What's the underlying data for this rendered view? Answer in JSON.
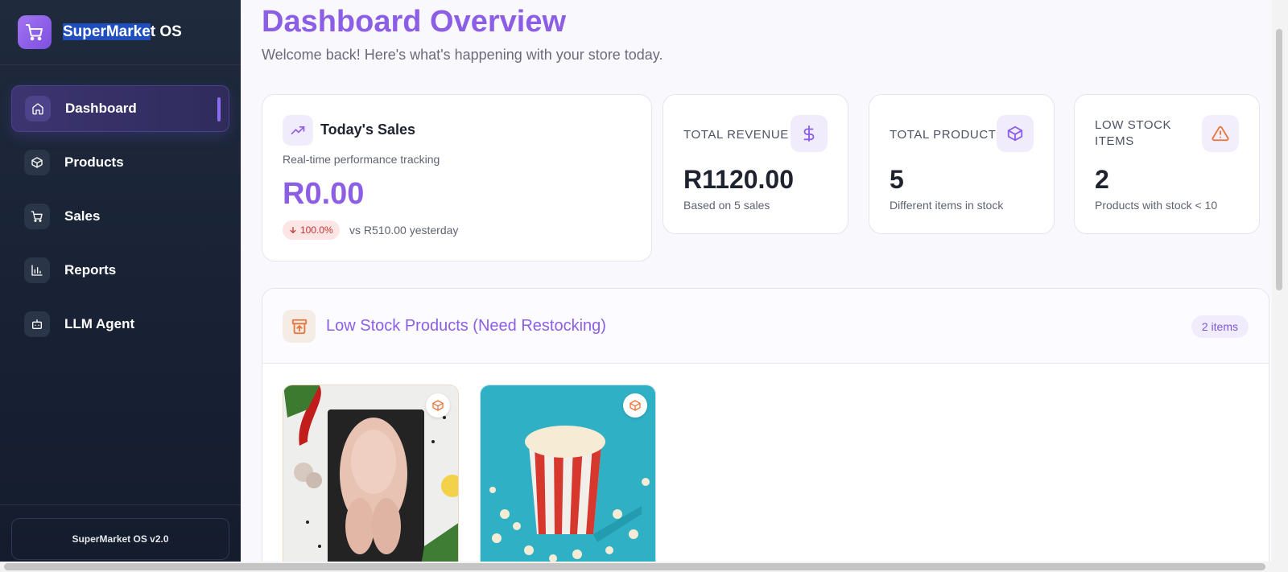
{
  "brand": {
    "name_part1": "SuperMarke",
    "name_part2": "t OS"
  },
  "nav": {
    "items": [
      {
        "label": "Dashboard",
        "icon": "home-icon",
        "active": true
      },
      {
        "label": "Products",
        "icon": "box-icon"
      },
      {
        "label": "Sales",
        "icon": "cart-icon"
      },
      {
        "label": "Reports",
        "icon": "bar-chart-icon"
      },
      {
        "label": "LLM Agent",
        "icon": "bot-icon"
      }
    ]
  },
  "footer": {
    "version": "SuperMarket OS v2.0"
  },
  "header": {
    "title": "Dashboard Overview",
    "subtitle": "Welcome back! Here's what's happening with your store today."
  },
  "sales_card": {
    "title": "Today's Sales",
    "subtitle": "Real-time performance tracking",
    "amount": "R0.00",
    "delta": "100.0%",
    "comparison": "vs R510.00 yesterday"
  },
  "stats": [
    {
      "label": "TOTAL REVENUE",
      "value": "R1120.00",
      "sub": "Based on 5 sales",
      "icon": "dollar-icon"
    },
    {
      "label": "TOTAL PRODUCTS",
      "value": "5",
      "sub": "Different items in stock",
      "icon": "package-icon"
    },
    {
      "label": "LOW STOCK ITEMS",
      "value": "2",
      "sub": "Products with stock < 10",
      "icon": "warning-icon"
    }
  ],
  "low_stock": {
    "title": "Low Stock Products (Need Restocking)",
    "count": "2 items",
    "products": [
      {
        "image": "raw-chicken-photo"
      },
      {
        "image": "popcorn-photo"
      }
    ]
  },
  "colors": {
    "accent": "#8c5ee6",
    "sidebar_bg": "#182134",
    "danger": "#c53232",
    "warning": "#e8743a"
  }
}
